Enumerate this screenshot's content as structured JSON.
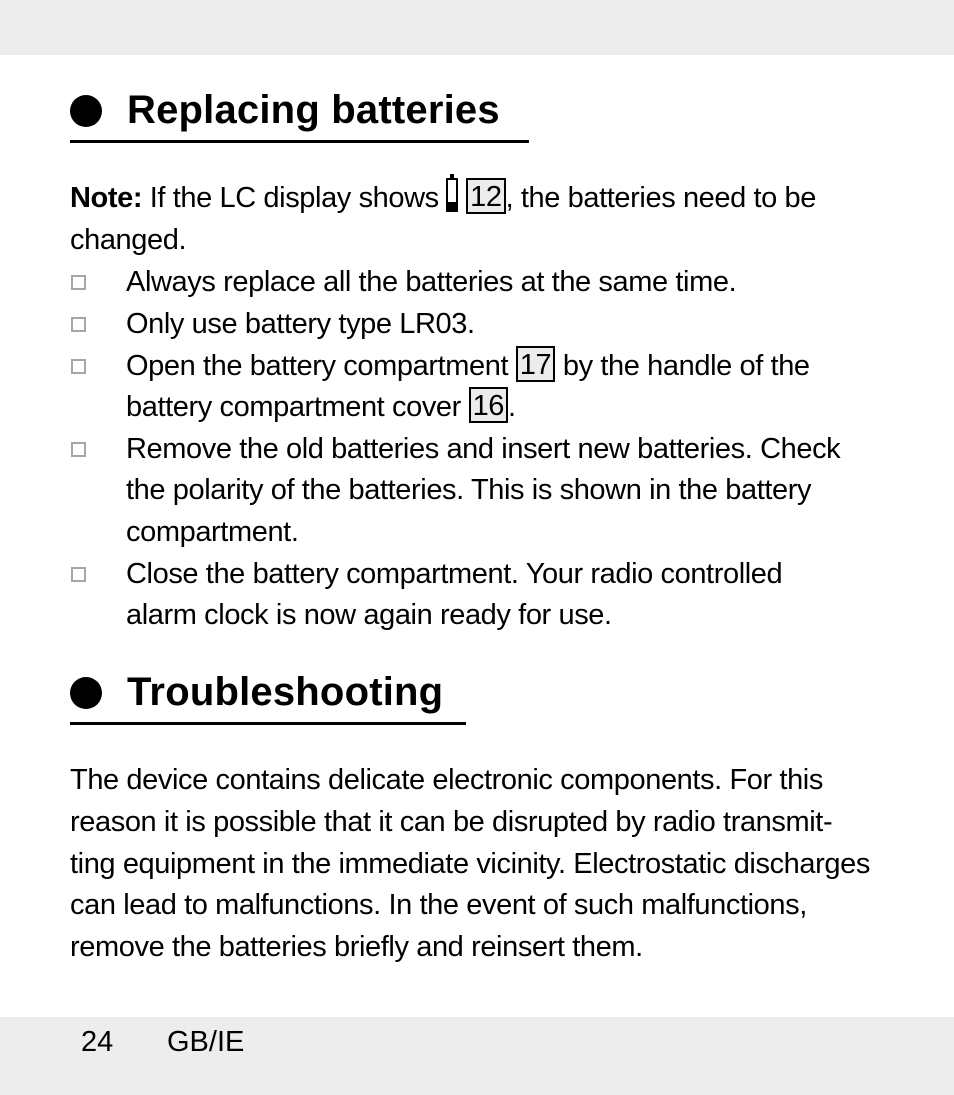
{
  "page": {
    "number": "24",
    "locale": "GB/IE"
  },
  "sections": [
    {
      "title": "Replacing batteries",
      "note": {
        "label": "Note:",
        "text_before": " If the LC display shows ",
        "battery_icon": "low-battery-icon",
        "ref": "12",
        "text_after": ", the batteries need to be",
        "text_line2": "changed."
      },
      "items": [
        {
          "lines": [
            "Always replace all the batteries at the same time."
          ]
        },
        {
          "lines": [
            "Only use battery type LR03."
          ]
        },
        {
          "line1_before": "Open the battery compartment ",
          "line1_ref": "17",
          "line1_after": " by the handle of the",
          "line2_before": "battery compartment cover ",
          "line2_ref": "16",
          "line2_after": "."
        },
        {
          "lines": [
            "Remove the old batteries and insert new batteries. Check",
            "the polarity of the batteries. This is shown in the battery",
            "compartment."
          ]
        },
        {
          "lines": [
            "Close the battery compartment. Your radio controlled",
            "alarm clock is now again ready for use."
          ]
        }
      ]
    },
    {
      "title": "Troubleshooting",
      "paragraph": [
        "The device contains delicate electronic components. For this",
        "reason it is possible that it can be disrupted by radio transmit-",
        "ting equipment in the immediate vicinity. Electrostatic discharges",
        "can lead to malfunctions. In the event of such malfunctions,",
        "remove the batteries briefly and reinsert them."
      ]
    }
  ]
}
